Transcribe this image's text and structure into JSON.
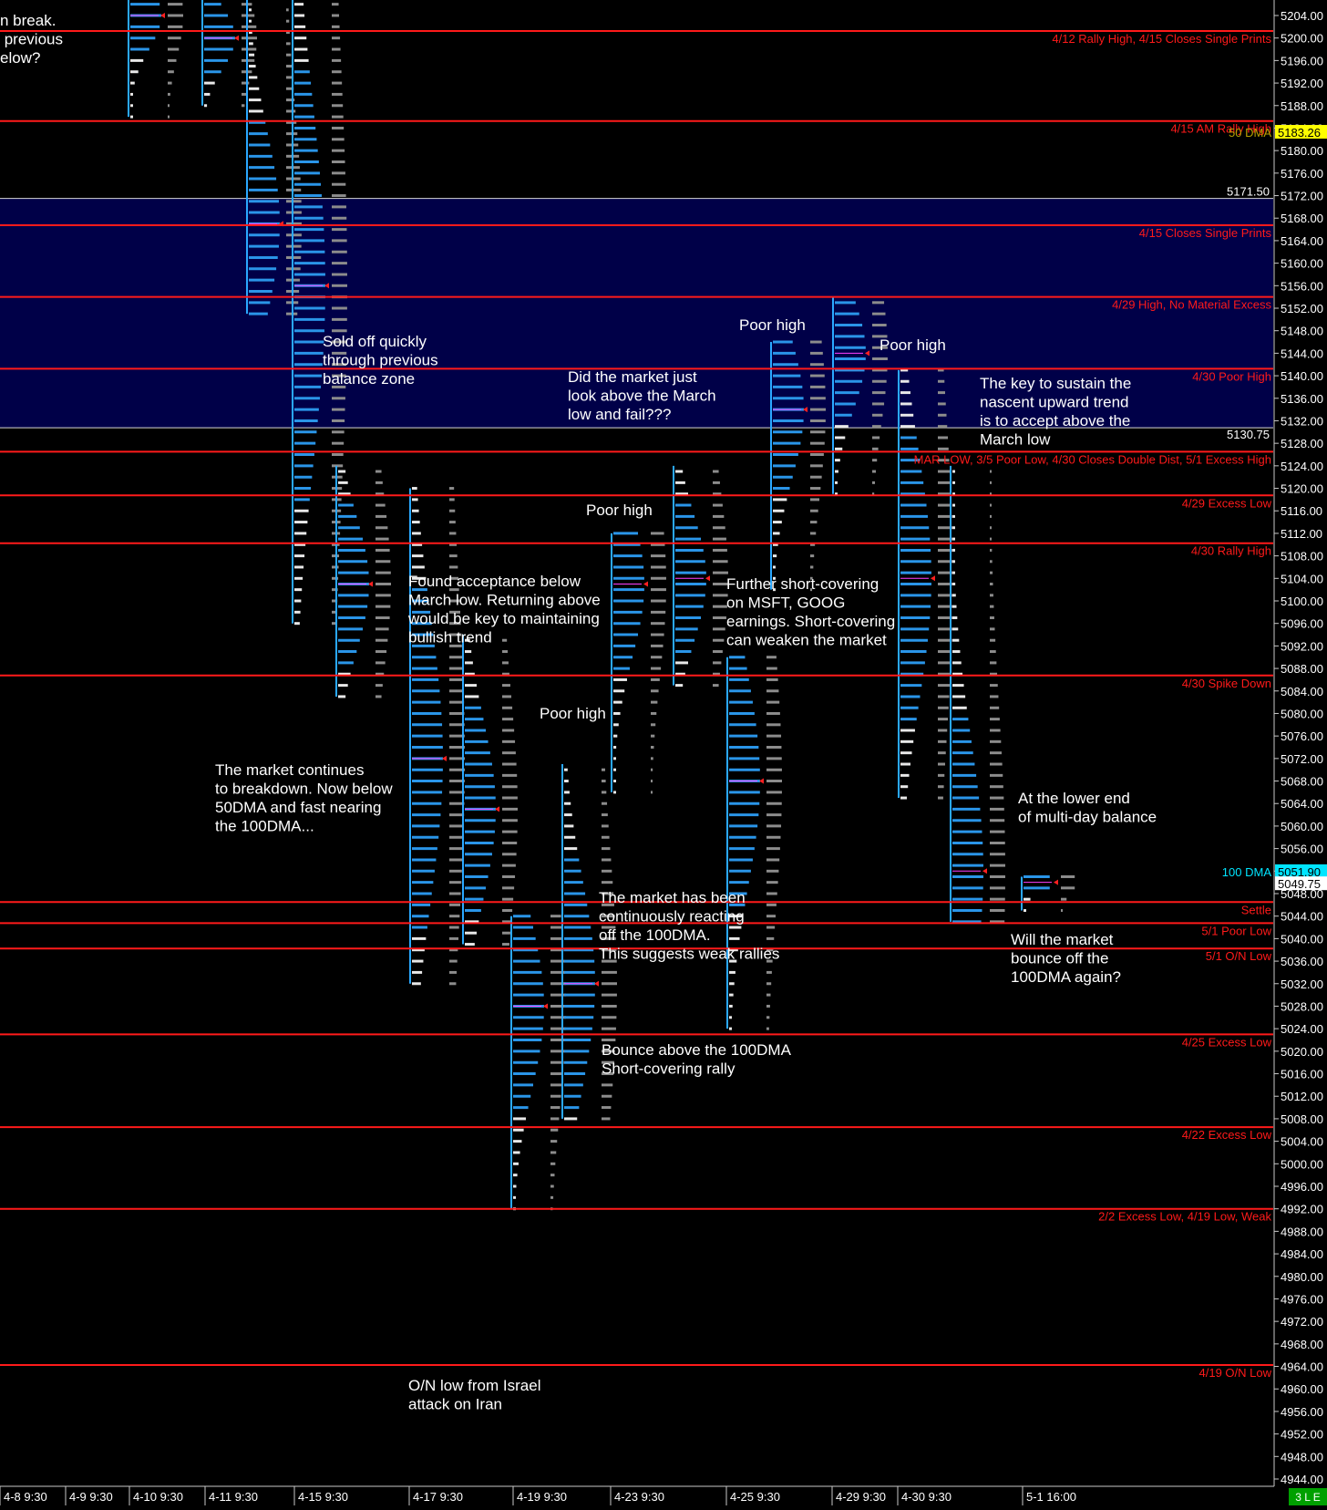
{
  "chart_data": {
    "type": "market-profile",
    "ylim": [
      4942,
      5207.5
    ],
    "y_ticks": [
      5204,
      5200,
      5196,
      5192,
      5188,
      5184,
      5180,
      5176,
      5172,
      5168,
      5164,
      5160,
      5156,
      5152,
      5148,
      5144,
      5140,
      5136,
      5132,
      5128,
      5124,
      5120,
      5116,
      5112,
      5108,
      5104,
      5100,
      5096,
      5092,
      5088,
      5084,
      5080,
      5076,
      5072,
      5068,
      5064,
      5060,
      5056,
      5052,
      5048,
      5044,
      5040,
      5036,
      5032,
      5028,
      5024,
      5020,
      5016,
      5012,
      5008,
      5004,
      5000,
      4996,
      4992,
      4988,
      4984,
      4980,
      4976,
      4972,
      4968,
      4964,
      4960,
      4956,
      4952,
      4948,
      4944
    ],
    "x_sessions": [
      "4-8  9:30",
      "4-9  9:30",
      "4-10  9:30",
      "4-11  9:30",
      "4-15  9:30",
      "4-17  9:30",
      "4-19  9:30",
      "4-23  9:30",
      "4-25  9:30",
      "4-29  9:30",
      "4-30  9:30",
      "5-1  16:00"
    ],
    "status_badge": "3 L E",
    "reference_lines": [
      {
        "price": 5201.25,
        "label": "4/12 Rally High, 4/15 Closes Single Prints"
      },
      {
        "price": 5185.25,
        "label": "4/15 AM Rally High"
      },
      {
        "price": 5166.75,
        "label": "4/15 Closes Single Prints"
      },
      {
        "price": 5154.0,
        "label": "4/29 High, No Material Excess"
      },
      {
        "price": 5141.25,
        "label": "4/30 Poor High"
      },
      {
        "price": 5126.5,
        "label": "MAR LOW, 3/5 Poor Low, 4/30 Closes Double Dist, 5/1 Excess High"
      },
      {
        "price": 5118.75,
        "label": "4/29 Excess Low"
      },
      {
        "price": 5110.25,
        "label": "4/30 Rally High"
      },
      {
        "price": 5086.75,
        "label": "4/30 Spike Down"
      },
      {
        "price": 5046.5,
        "label": "Settle"
      },
      {
        "price": 5042.75,
        "label": "5/1 Poor Low"
      },
      {
        "price": 5038.25,
        "label": "5/1 O/N Low"
      },
      {
        "price": 5023.0,
        "label": "4/25 Excess Low"
      },
      {
        "price": 5006.5,
        "label": "4/22 Excess Low"
      },
      {
        "price": 4992.0,
        "label": "2/2 Excess Low, 4/19 Low, Weak"
      },
      {
        "price": 4964.25,
        "label": "4/19 O/N Low"
      }
    ],
    "zones": [
      {
        "top": 5171.5,
        "bottom": 5130.75,
        "top_label": "5171.50",
        "bottom_label": "5130.75"
      }
    ],
    "price_badges": [
      {
        "price": 5183.26,
        "text": "5183.26",
        "bg": "#ffff00",
        "fg": "#000000"
      },
      {
        "price": 5051.9,
        "text": "5051.90",
        "bg": "#00e5ff",
        "fg": "#000000"
      },
      {
        "price": 5049.75,
        "text": "5049.75",
        "bg": "#ffffff",
        "fg": "#000000"
      }
    ],
    "dma_labels": [
      {
        "price": 5183.26,
        "text": "50 DMA",
        "color": "#b8a000"
      },
      {
        "price": 5051.9,
        "text": "100 DMA",
        "color": "#00e5ff"
      }
    ],
    "profiles": [
      {
        "high": 5207,
        "low": 5186,
        "poc": 5204
      },
      {
        "high": 5207,
        "low": 5188,
        "poc": 5200
      },
      {
        "high": 5207,
        "low": 5151,
        "poc": 5167
      },
      {
        "high": 5207,
        "low": 5096,
        "poc": 5156
      },
      {
        "high": 5124,
        "low": 5083,
        "poc": 5103
      },
      {
        "high": 5120,
        "low": 5032,
        "poc": 5072
      },
      {
        "high": 5094,
        "low": 5039,
        "poc": 5063
      },
      {
        "high": 5044,
        "low": 4992,
        "poc": 5028
      },
      {
        "high": 5071,
        "low": 5008,
        "poc": 5032
      },
      {
        "high": 5112,
        "low": 5066,
        "poc": 5103
      },
      {
        "high": 5124,
        "low": 5085,
        "poc": 5104
      },
      {
        "high": 5090,
        "low": 5024,
        "poc": 5068
      },
      {
        "high": 5146,
        "low": 5102,
        "poc": 5134
      },
      {
        "high": 5154,
        "low": 5119,
        "poc": 5144
      },
      {
        "high": 5141,
        "low": 5065,
        "poc": 5104
      },
      {
        "high": 5124,
        "low": 5043,
        "poc": 5052
      },
      {
        "high": 5051,
        "low": 5045,
        "poc": 5050
      }
    ],
    "annotations": [
      {
        "lines": [
          "n break.",
          " previous",
          "elow?"
        ]
      },
      {
        "lines": [
          "Sold off quickly",
          "through previous",
          "balance zone"
        ]
      },
      {
        "lines": [
          "Did the market just",
          "look above the March",
          "low and fail???"
        ]
      },
      {
        "lines": [
          "Poor high"
        ]
      },
      {
        "lines": [
          "Poor high"
        ]
      },
      {
        "lines": [
          "The key to sustain the",
          "nascent upward trend",
          "is to accept above the",
          "March low"
        ]
      },
      {
        "lines": [
          "Poor high"
        ]
      },
      {
        "lines": [
          "Found acceptance below",
          "March low. Returning above",
          "would be key to maintaining",
          "bullish trend"
        ]
      },
      {
        "lines": [
          "Further short-covering",
          "on MSFT, GOOG",
          "earnings. Short-covering",
          "can weaken the market"
        ]
      },
      {
        "lines": [
          "Poor high"
        ]
      },
      {
        "lines": [
          "The market continues",
          "to breakdown. Now below",
          "50DMA and fast nearing",
          "the 100DMA..."
        ]
      },
      {
        "lines": [
          "At the lower end",
          "of multi-day balance"
        ]
      },
      {
        "lines": [
          "The market has been",
          "continuously reacting",
          "off the 100DMA.",
          "This suggests weak rallies"
        ]
      },
      {
        "lines": [
          "Will the market",
          "bounce off the",
          "100DMA again?"
        ]
      },
      {
        "lines": [
          "Bounce above the 100DMA",
          "Short-covering rally"
        ]
      },
      {
        "lines": [
          "O/N low from Israel",
          "attack on Iran"
        ]
      }
    ]
  }
}
